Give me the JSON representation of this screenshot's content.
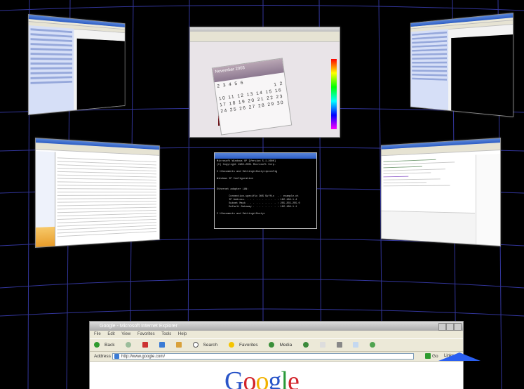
{
  "colors": {
    "grid": "#3b3fb5",
    "accent": "#2c5cc4",
    "background": "#000000"
  },
  "calendar": {
    "month_year": "November 2003",
    "day_rows": [
      "2 3 4 5 6",
      "1 2",
      "10 11 12 13 14 15 16",
      "17 18 19 20 21 22 23",
      "24 25 26 27 28 29 30"
    ]
  },
  "console": {
    "lines": [
      "Microsoft Windows XP [Version 5.1.2600]",
      "(C) Copyright 1985-2001 Microsoft Corp.",
      "",
      "C:\\Documents and Settings\\Dusty>ipconfig",
      "",
      "Windows IP Configuration",
      "",
      "",
      "Ethernet adapter LAN:",
      "",
      "        Connection-specific DNS Suffix  . : example.ch",
      "        IP Address. . . . . . . . . . . : 192.168.1.4",
      "        Subnet Mask . . . . . . . . . . : 255.255.255.0",
      "        Default Gateway . . . . . . . . : 192.168.1.1",
      "",
      "C:\\Documents and Settings\\Dusty>"
    ]
  },
  "ie": {
    "title": "Google - Microsoft Internet Explorer",
    "menu": [
      "File",
      "Edit",
      "View",
      "Favorites",
      "Tools",
      "Help"
    ],
    "toolbar": {
      "back": "Back",
      "search": "Search",
      "favorites": "Favorites",
      "media": "Media"
    },
    "address_label": "Address",
    "address_url": "http://www.google.com/",
    "go_label": "Go",
    "links_label": "Links",
    "page_logo": "Google"
  }
}
